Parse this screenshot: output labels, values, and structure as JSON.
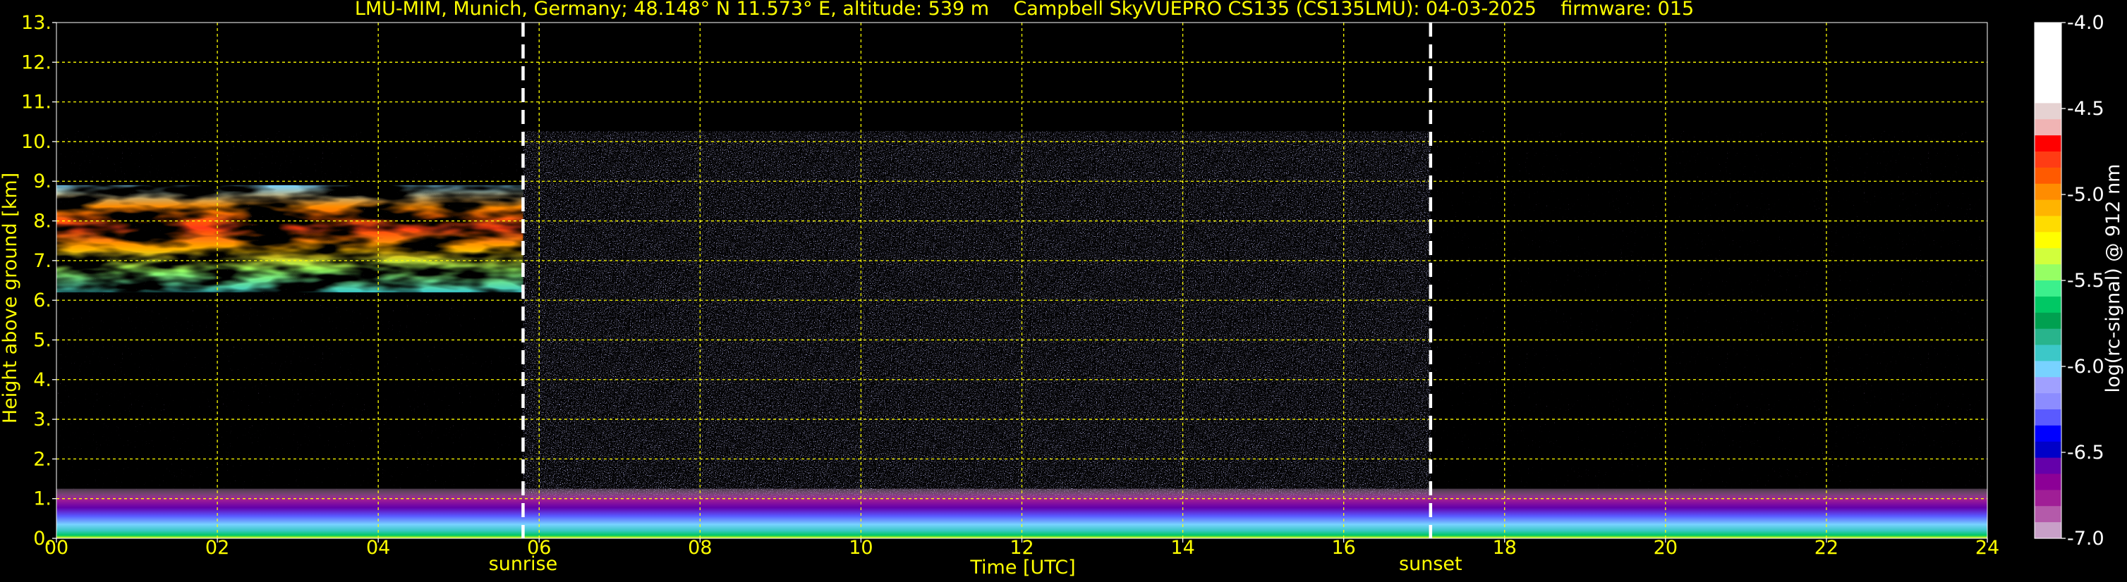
{
  "chart_data": {
    "type": "heatmap",
    "title": "LMU-MIM, Munich, Germany; 48.148° N 11.573° E, altitude: 539 m    Campbell SkyVUEPRO CS135 (CS135LMU): 04-03-2025    firmware: 015",
    "xlabel": "Time [UTC]",
    "ylabel": "Height above ground [km]",
    "xlim": [
      0,
      24
    ],
    "ylim": [
      0,
      13
    ],
    "x_ticks": [
      0,
      2,
      4,
      6,
      8,
      10,
      12,
      14,
      16,
      18,
      20,
      22,
      24
    ],
    "x_tick_labels": [
      "00",
      "02",
      "04",
      "06",
      "08",
      "10",
      "12",
      "14",
      "16",
      "18",
      "20",
      "22",
      "24"
    ],
    "y_ticks": [
      0,
      1,
      2,
      3,
      4,
      5,
      6,
      7,
      8,
      9,
      10,
      11,
      12,
      13
    ],
    "y_tick_labels": [
      "0.",
      "1.",
      "2.",
      "3.",
      "4.",
      "5.",
      "6.",
      "7.",
      "8.",
      "9.",
      "10.",
      "11.",
      "12.",
      "13."
    ],
    "grid": true,
    "grid_color": "#ffff00",
    "events": [
      {
        "label": "sunrise",
        "x": 5.8
      },
      {
        "label": "sunset",
        "x": 17.08
      }
    ],
    "data_top_km": 10.25,
    "features": {
      "boundary_layer_top_km": 1.0,
      "cloud_layer": {
        "x_range": [
          0,
          5.8
        ],
        "base_km": 6.2,
        "top_km": 8.9
      },
      "noisy_daytime_range": [
        5.8,
        17.08
      ]
    },
    "colorbar": {
      "label": "log(rc-signal) @ 912 nm",
      "min": -7.0,
      "max": -4.0,
      "ticks": [
        "-4.0",
        "-4.5",
        "-5.0",
        "-5.5",
        "-6.0",
        "-6.5",
        "-7.0"
      ],
      "tick_values": [
        -4.0,
        -4.5,
        -5.0,
        -5.5,
        -6.0,
        -6.5,
        -7.0
      ],
      "colors": [
        "#ffffff",
        "#ffffff",
        "#ffffff",
        "#ffffff",
        "#ffffff",
        "#e6d2d2",
        "#f0b4b4",
        "#ff0000",
        "#ff3c14",
        "#ff5a00",
        "#ff8c00",
        "#ffb400",
        "#ffdc00",
        "#ffff00",
        "#d2ff3c",
        "#96ff64",
        "#3cf08c",
        "#00c864",
        "#00a050",
        "#28b48c",
        "#3cc8c8",
        "#78d2ff",
        "#a0a0ff",
        "#8c8cff",
        "#5a5aff",
        "#0000ff",
        "#0000c8",
        "#6400aa",
        "#8c0096",
        "#a01e96",
        "#b45aaa",
        "#c8a0c8"
      ]
    }
  }
}
